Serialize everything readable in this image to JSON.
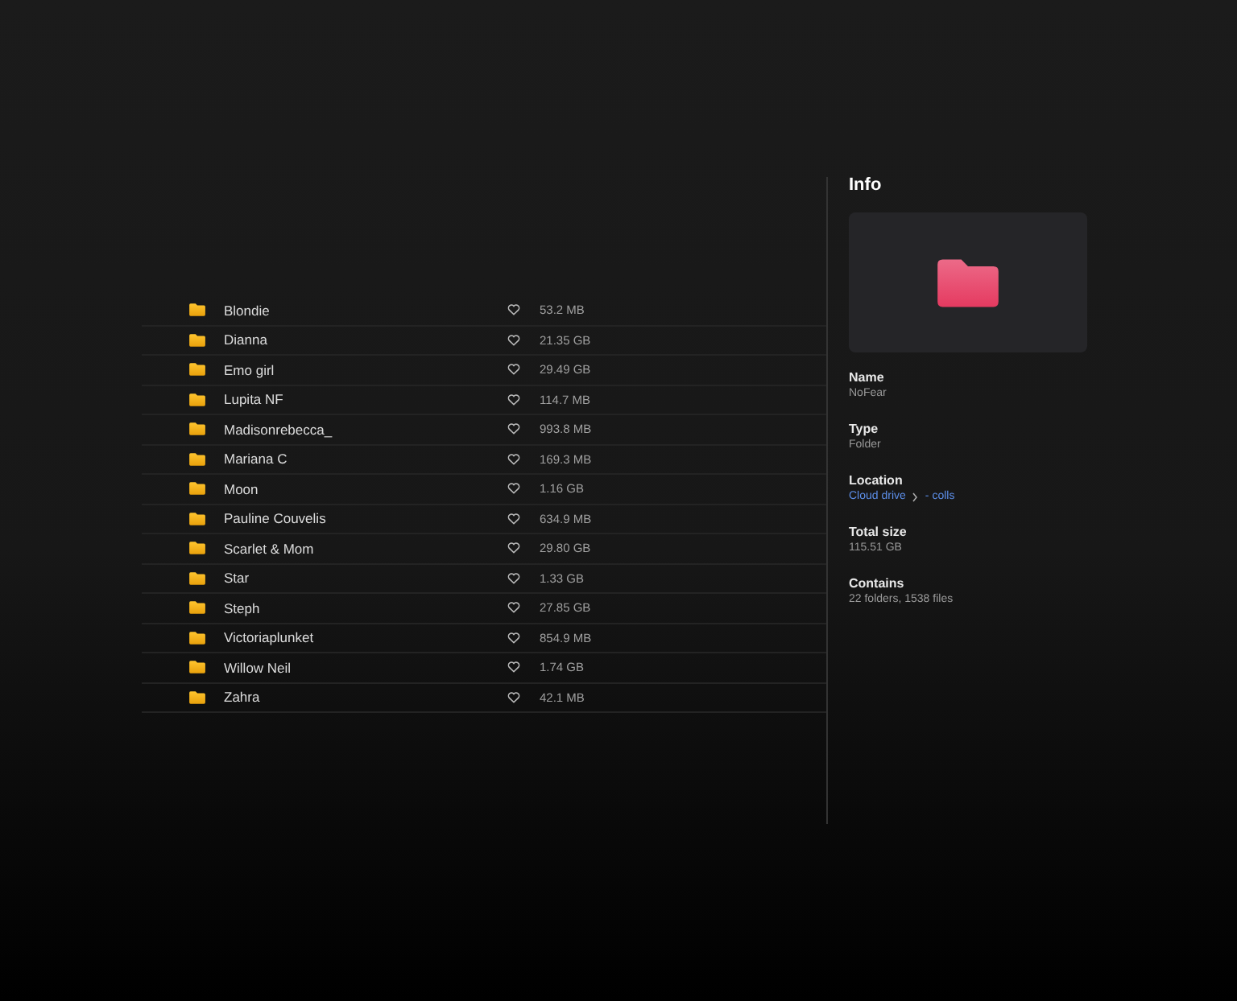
{
  "files": [
    {
      "name": "Blondie",
      "size": "53.2 MB"
    },
    {
      "name": "Dianna",
      "size": "21.35 GB"
    },
    {
      "name": "Emo girl",
      "size": "29.49 GB"
    },
    {
      "name": "Lupita NF",
      "size": "114.7 MB"
    },
    {
      "name": "Madisonrebecca_",
      "size": "993.8 MB"
    },
    {
      "name": "Mariana C",
      "size": "169.3 MB"
    },
    {
      "name": "Moon",
      "size": "1.16 GB"
    },
    {
      "name": "Pauline Couvelis",
      "size": "634.9 MB"
    },
    {
      "name": "Scarlet & Mom",
      "size": "29.80 GB"
    },
    {
      "name": "Star",
      "size": "1.33 GB"
    },
    {
      "name": "Steph",
      "size": "27.85 GB"
    },
    {
      "name": "Victoriaplunket",
      "size": "854.9 MB"
    },
    {
      "name": "Willow Neil",
      "size": "1.74 GB"
    },
    {
      "name": "Zahra",
      "size": "42.1 MB"
    }
  ],
  "info": {
    "title": "Info",
    "fields": [
      {
        "kind": "text",
        "label": "Name",
        "value": "NoFear"
      },
      {
        "kind": "text",
        "label": "Type",
        "value": "Folder"
      },
      {
        "kind": "path",
        "label": "Location",
        "path": [
          "Cloud drive",
          "- colls"
        ]
      },
      {
        "kind": "text",
        "label": "Total size",
        "value": "115.51 GB"
      },
      {
        "kind": "text",
        "label": "Contains",
        "value": "22 folders, 1538 files"
      }
    ]
  }
}
